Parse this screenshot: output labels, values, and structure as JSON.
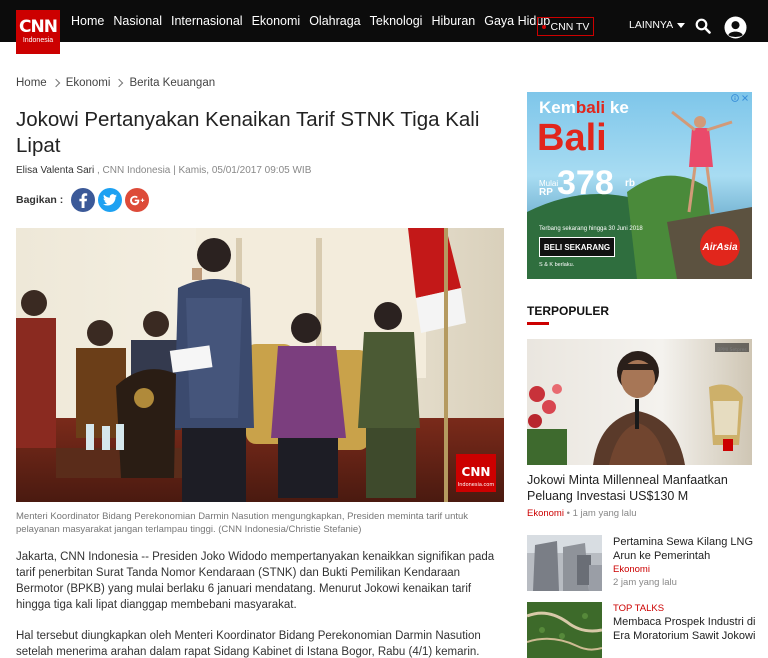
{
  "nav": {
    "logo_big": "CNN",
    "logo_small": "Indonesia",
    "items": [
      "Home",
      "Nasional",
      "Internasional",
      "Ekonomi",
      "Olahraga",
      "Teknologi",
      "Hiburan",
      "Gaya Hidup"
    ],
    "tv_label": "CNN TV",
    "more_label": "LAINNYA"
  },
  "breadcrumb": [
    "Home",
    "Ekonomi",
    "Berita Keuangan"
  ],
  "article": {
    "title": "Jokowi Pertanyakan Kenaikan Tarif STNK Tiga Kali Lipat",
    "author": "Elisa Valenta Sari",
    "meta": " , CNN Indonesia | Kamis, 05/01/2017 09:05 WIB",
    "share_label": "Bagikan :",
    "image_watermark": "CNN",
    "image_watermark_sub": "Indonesia.com",
    "caption": "Menteri Koordinator Bidang Perekonomian Darmin Nasution mengungkapkan, Presiden meminta tarif untuk pelayanan masyarakat jangan terlampau tinggi. (CNN Indonesia/Christie Stefanie)",
    "paragraphs": [
      "Jakarta, CNN Indonesia -- Presiden Joko Widodo mempertanyakan kenaikkan signifikan pada tarif penerbitan Surat Tanda Nomor Kendaraan (STNK) dan Bukti Pemilikan Kendaraan Bermotor (BPKB) yang mulai berlaku 6 januari mendatang. Menurut Jokowi kenaikan tarif hingga tiga kali lipat dianggap membebani masyarakat.",
      "Hal tersebut diungkapkan oleh Menteri Koordinator Bidang Perekonomian Darmin Nasution setelah menerima arahan dalam rapat Sidang Kabinet di Istana Bogor, Rabu (4/1) kemarin."
    ]
  },
  "ad": {
    "headline_1": "Kem",
    "headline_2": "bali",
    "headline_3": " ke",
    "headline_big": "Bali",
    "price_prefix_1": "Mulai",
    "price_prefix_2": "RP",
    "price": "378",
    "price_suffix": "rb",
    "period": "Terbang sekarang hingga 30 Juni 2018",
    "cta": "BELI SEKARANG",
    "terms": "S & K berlaku.",
    "brand": "AirAsia"
  },
  "sidebar": {
    "section_title": "TERPOPULER",
    "main_item": {
      "title": "Jokowi Minta Millenneal Manfaatkan Peluang Investasi US$130 M",
      "category": "Ekonomi",
      "time": " • 1 jam yang lalu",
      "image_tag": "BPMI Setpres"
    },
    "items": [
      {
        "title": "Pertamina Sewa Kilang LNG Arun ke Pemerintah",
        "category": "Ekonomi",
        "time": "2 jam yang lalu"
      },
      {
        "title": "Membaca Prospek Industri di Era Moratorium Sawit Jokowi",
        "category": "TOP TALKS",
        "time": ""
      }
    ]
  },
  "colors": {
    "brand_red": "#cc0000",
    "nav_bg": "#0c0c0c",
    "facebook": "#3b5998",
    "twitter": "#1da1f2",
    "google": "#dd4b39"
  }
}
